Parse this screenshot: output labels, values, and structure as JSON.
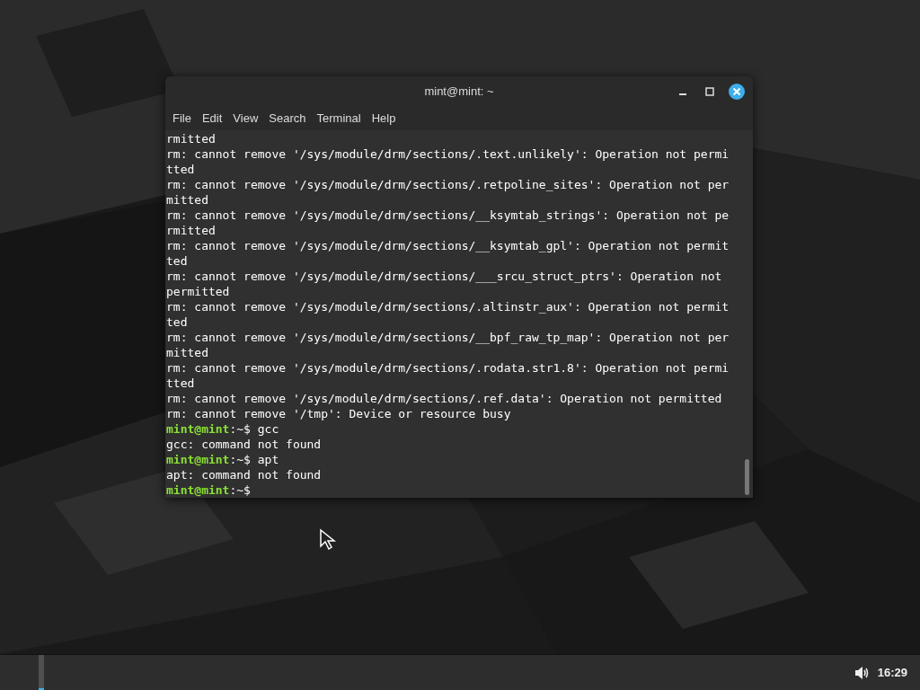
{
  "terminal": {
    "title": "mint@mint: ~",
    "menu": [
      "File",
      "Edit",
      "View",
      "Search",
      "Terminal",
      "Help"
    ],
    "lines": [
      {
        "kind": "output",
        "text": "rmitted"
      },
      {
        "kind": "output",
        "text": "rm: cannot remove '/sys/module/drm/sections/.text.unlikely': Operation not permi"
      },
      {
        "kind": "output",
        "text": "tted"
      },
      {
        "kind": "output",
        "text": "rm: cannot remove '/sys/module/drm/sections/.retpoline_sites': Operation not per"
      },
      {
        "kind": "output",
        "text": "mitted"
      },
      {
        "kind": "output",
        "text": "rm: cannot remove '/sys/module/drm/sections/__ksymtab_strings': Operation not pe"
      },
      {
        "kind": "output",
        "text": "rmitted"
      },
      {
        "kind": "output",
        "text": "rm: cannot remove '/sys/module/drm/sections/__ksymtab_gpl': Operation not permit"
      },
      {
        "kind": "output",
        "text": "ted"
      },
      {
        "kind": "output",
        "text": "rm: cannot remove '/sys/module/drm/sections/___srcu_struct_ptrs': Operation not"
      },
      {
        "kind": "output",
        "text": "permitted"
      },
      {
        "kind": "output",
        "text": "rm: cannot remove '/sys/module/drm/sections/.altinstr_aux': Operation not permit"
      },
      {
        "kind": "output",
        "text": "ted"
      },
      {
        "kind": "output",
        "text": "rm: cannot remove '/sys/module/drm/sections/__bpf_raw_tp_map': Operation not per"
      },
      {
        "kind": "output",
        "text": "mitted"
      },
      {
        "kind": "output",
        "text": "rm: cannot remove '/sys/module/drm/sections/.rodata.str1.8': Operation not permi"
      },
      {
        "kind": "output",
        "text": "tted"
      },
      {
        "kind": "output",
        "text": "rm: cannot remove '/sys/module/drm/sections/.ref.data': Operation not permitted"
      },
      {
        "kind": "output",
        "text": "rm: cannot remove '/tmp': Device or resource busy"
      },
      {
        "kind": "prompt",
        "user": "mint@mint",
        "text": ":~$ gcc"
      },
      {
        "kind": "output",
        "text": "gcc: command not found"
      },
      {
        "kind": "prompt",
        "user": "mint@mint",
        "text": ":~$ apt"
      },
      {
        "kind": "output",
        "text": "apt: command not found"
      },
      {
        "kind": "prompt",
        "user": "mint@mint",
        "text": ":~$"
      }
    ]
  },
  "taskbar": {
    "clock": "16:29"
  }
}
